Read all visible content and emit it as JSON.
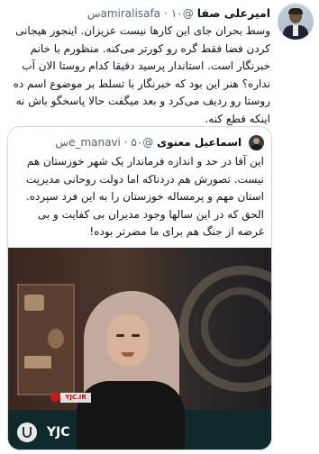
{
  "tweet": {
    "author_name": "امیرعلی صفا",
    "author_handle": "@amiralisafa",
    "separator": "·",
    "time": "۱۰س",
    "text": "وسط بحران جای این کارها نیست عزیزان. اینجور هیجانی کردن فضا فقط گره رو کورتر می‌کنه. منظورم با خانم خبرنگار است. استاندار پرسید دقیقا کدام روستا الان آب نداره؟ هنر این بود که خبرنگار با تسلط بر موضوع اسم ده روستا رو ردیف می‌کرد و بعد میگفت حالا پاسخگو باش نه اینکه قطع کنه."
  },
  "quoted_tweet": {
    "author_name": "اسماعیل معنوی",
    "author_handle": "@e_manavi",
    "separator": "·",
    "time": "۵۰س",
    "text": "این آقا در حد و اندازه فرماندار یک شهر خوزستان هم نیست. تصورش هم دردناکه اما دولت روحانی مدیریت استان مهم و پرمساله خوزستان را به این فرد سپرده. الحق که در این سالها وجود مدیران بی کفایت و بی غرضه از جنگ هم برای ما مضرتر بوده!",
    "video": {
      "watermark": "YJC",
      "channel_badge": "YJC.IR"
    }
  }
}
